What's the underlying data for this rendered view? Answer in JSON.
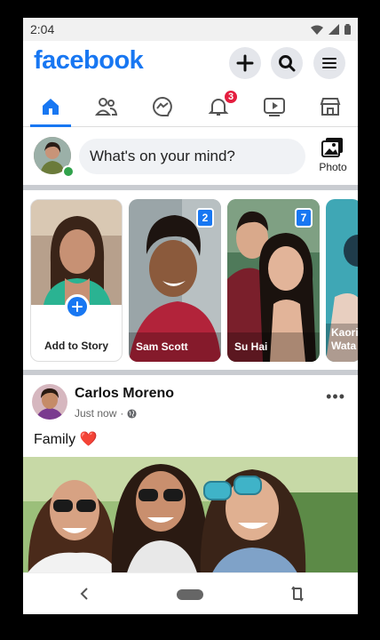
{
  "status_bar": {
    "time": "2:04"
  },
  "header": {
    "logo": "facebook"
  },
  "tabs": [
    {
      "name": "home",
      "active": true
    },
    {
      "name": "friends",
      "active": false
    },
    {
      "name": "messenger",
      "active": false
    },
    {
      "name": "notifications",
      "active": false,
      "badge": "3"
    },
    {
      "name": "watch",
      "active": false
    },
    {
      "name": "marketplace",
      "active": false
    }
  ],
  "composer": {
    "placeholder": "What's on your mind?",
    "photo_label": "Photo"
  },
  "stories": {
    "add_label": "Add to Story",
    "items": [
      {
        "name": "Sam Scott",
        "count": "2"
      },
      {
        "name": "Su Hai",
        "count": "7"
      },
      {
        "name": "Kaori Wata"
      }
    ]
  },
  "post": {
    "author": "Carlos Moreno",
    "time": "Just now",
    "dot": "·",
    "text": "Family",
    "emoji": "❤️"
  },
  "colors": {
    "brand": "#1877f2",
    "badge": "#e41e3f",
    "online": "#31a24c"
  }
}
